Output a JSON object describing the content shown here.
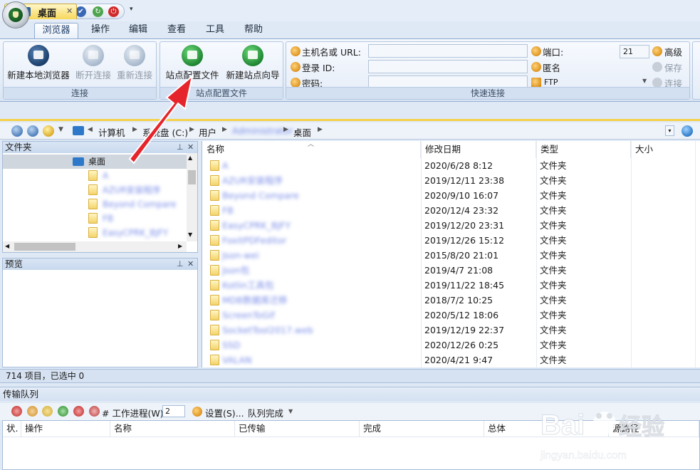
{
  "quick_access": {
    "icons": [
      "site-manager-icon",
      "local-browser-icon",
      "reconnect-icon",
      "refresh-icon",
      "power-icon"
    ],
    "more_glyph": "▾"
  },
  "ribbon": {
    "tabs": [
      {
        "label": "浏览器",
        "active": true
      },
      {
        "label": "操作"
      },
      {
        "label": "编辑"
      },
      {
        "label": "查看"
      },
      {
        "label": "工具"
      },
      {
        "label": "帮助"
      }
    ],
    "groups": {
      "connect": {
        "label": "连接",
        "buttons": [
          {
            "label": "新建本地浏览器",
            "icon": "monitor-icon",
            "enabled": true
          },
          {
            "label": "断开连接",
            "icon": "disconnect-icon",
            "enabled": false
          },
          {
            "label": "重新连接",
            "icon": "reconnect-icon",
            "enabled": false
          }
        ]
      },
      "site_profiles": {
        "label": "站点配置文件",
        "buttons": [
          {
            "label": "站点配置文件",
            "icon": "site-profile-icon"
          },
          {
            "label": "新建站点向导",
            "icon": "new-site-wizard-icon"
          }
        ]
      },
      "quick_connect": {
        "label": "快速连接",
        "host_label": "主机名或 URL:",
        "host_value": "",
        "login_label": "登录 ID:",
        "login_value": "",
        "password_label": "密码:",
        "password_value": "",
        "port_label": "端口:",
        "port_value": "21",
        "anonymous_label": "匿名",
        "protocol": "FTP",
        "advanced_label": "高级",
        "save_label": "保存",
        "connect_label": "连接"
      }
    }
  },
  "document_tab": {
    "label": "桌面",
    "close": "✕"
  },
  "address": {
    "crumbs": [
      "计算机",
      "系统盘 (C:)",
      "用户",
      "Administrator",
      "桌面"
    ],
    "dropdown_glyph": "▾"
  },
  "folders_pane": {
    "title": "文件夹",
    "root": "桌面",
    "items": [
      "A",
      "AZUR安装程序",
      "Beyond Compare",
      "FB",
      "EasyCPRK_BJFY"
    ]
  },
  "preview_pane": {
    "title": "预览"
  },
  "file_list": {
    "columns": [
      "名称",
      "修改日期",
      "类型",
      "大小"
    ],
    "rows": [
      {
        "name": "A",
        "date": "2020/6/28 8:12",
        "type": "文件夹"
      },
      {
        "name": "AZUR安装程序",
        "date": "2019/12/11 23:38",
        "type": "文件夹"
      },
      {
        "name": "Beyond Compare",
        "date": "2020/9/10 16:07",
        "type": "文件夹"
      },
      {
        "name": "FB",
        "date": "2020/12/4 23:32",
        "type": "文件夹"
      },
      {
        "name": "EasyCPRK_BJFY",
        "date": "2019/12/20 23:31",
        "type": "文件夹"
      },
      {
        "name": "FoxitPDFeditor",
        "date": "2019/12/26 15:12",
        "type": "文件夹"
      },
      {
        "name": "Json-wei",
        "date": "2015/8/20 21:01",
        "type": "文件夹"
      },
      {
        "name": "Json包",
        "date": "2019/4/7 21:08",
        "type": "文件夹"
      },
      {
        "name": "Kotlin工具包",
        "date": "2019/11/22 18:45",
        "type": "文件夹"
      },
      {
        "name": "MDB数据库迁移",
        "date": "2018/7/2 10:25",
        "type": "文件夹"
      },
      {
        "name": "ScreenToGif",
        "date": "2020/5/12 18:06",
        "type": "文件夹"
      },
      {
        "name": "SocketTool2017.web",
        "date": "2019/12/19 22:37",
        "type": "文件夹"
      },
      {
        "name": "SSD",
        "date": "2020/12/26 0:25",
        "type": "文件夹"
      },
      {
        "name": "VALAN",
        "date": "2020/4/21 9:47",
        "type": "文件夹"
      }
    ]
  },
  "status": {
    "text": "714 项目，已选中 0"
  },
  "queue": {
    "title": "传输队列",
    "work_label": "# 工作进程(W)",
    "work_value": "2",
    "settings_label": "设置(S)...",
    "completion_label": "队列完成",
    "columns": [
      "状.",
      "操作",
      "名称",
      "已传输",
      "完成",
      "总体",
      "源路径"
    ]
  },
  "colors": {
    "accent": "#1f3d6b",
    "tab_highlight": "#f5d14a",
    "annotation_arrow": "#e5242b"
  }
}
